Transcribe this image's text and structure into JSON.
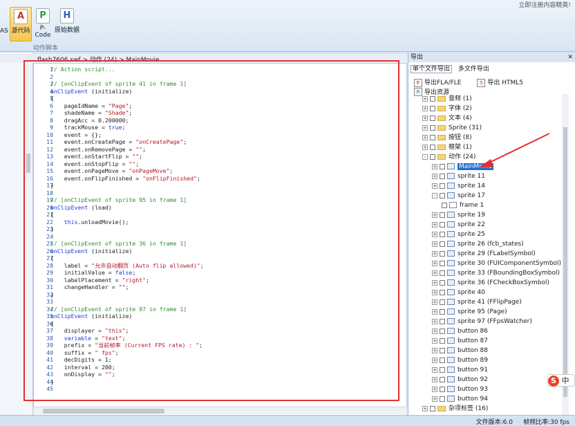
{
  "topright_text": "立即注册内容精英!",
  "ribbon": {
    "partial_label": "AS",
    "buttons": [
      {
        "label": "源代码",
        "icon": "A",
        "active": true
      },
      {
        "label": "P-Code",
        "icon": "P",
        "active": false
      },
      {
        "label": "原始数据",
        "icon": "H",
        "active": false
      }
    ],
    "group_label": "动作脚本"
  },
  "breadcrumb": "flash7606.swf > 动作 (24) > MainMovie",
  "code_lines": [
    [
      [
        "cm",
        "// Action script..."
      ]
    ],
    [],
    [
      [
        "cm",
        "// [onClipEvent of sprite 41 in frame 1]"
      ]
    ],
    [
      [
        "kw",
        "onClipEvent"
      ],
      [
        "pl",
        " (initialize)"
      ]
    ],
    [
      [
        "pl",
        "{"
      ]
    ],
    [
      [
        "pl",
        "    pageIdName = "
      ],
      [
        "st",
        "\"Page\""
      ],
      [
        "pl",
        ";"
      ]
    ],
    [
      [
        "pl",
        "    shadeName = "
      ],
      [
        "st",
        "\"Shade\""
      ],
      [
        "pl",
        ";"
      ]
    ],
    [
      [
        "pl",
        "    dragAcc = 0.200000;"
      ]
    ],
    [
      [
        "pl",
        "    trackMouse = "
      ],
      [
        "kw",
        "true"
      ],
      [
        "pl",
        ";"
      ]
    ],
    [
      [
        "pl",
        "    event = {};"
      ]
    ],
    [
      [
        "pl",
        "    event.onCreatePage = "
      ],
      [
        "st",
        "\"onCreatePage\""
      ],
      [
        "pl",
        ";"
      ]
    ],
    [
      [
        "pl",
        "    event.onRemovePage = "
      ],
      [
        "st",
        "\"\""
      ],
      [
        "pl",
        ";"
      ]
    ],
    [
      [
        "pl",
        "    event.onStartFlip = "
      ],
      [
        "st",
        "\"\""
      ],
      [
        "pl",
        ";"
      ]
    ],
    [
      [
        "pl",
        "    event.onStopFlip = "
      ],
      [
        "st",
        "\"\""
      ],
      [
        "pl",
        ";"
      ]
    ],
    [
      [
        "pl",
        "    event.onPageMove = "
      ],
      [
        "st",
        "\"onPageMove\""
      ],
      [
        "pl",
        ";"
      ]
    ],
    [
      [
        "pl",
        "    event.onFlipFinished = "
      ],
      [
        "st",
        "\"onFlipFinished\""
      ],
      [
        "pl",
        ";"
      ]
    ],
    [
      [
        "pl",
        "}"
      ]
    ],
    [],
    [
      [
        "cm",
        "// [onClipEvent of sprite 95 in frame 1]"
      ]
    ],
    [
      [
        "kw",
        "onClipEvent"
      ],
      [
        "pl",
        " (load)"
      ]
    ],
    [
      [
        "pl",
        "{"
      ]
    ],
    [
      [
        "pl",
        "    "
      ],
      [
        "kw",
        "this"
      ],
      [
        "pl",
        ".unloadMovie();"
      ]
    ],
    [
      [
        "pl",
        "}"
      ]
    ],
    [],
    [
      [
        "cm",
        "// [onClipEvent of sprite 36 in frame 1]"
      ]
    ],
    [
      [
        "kw",
        "onClipEvent"
      ],
      [
        "pl",
        " (initialize)"
      ]
    ],
    [
      [
        "pl",
        "{"
      ]
    ],
    [
      [
        "pl",
        "    label = "
      ],
      [
        "st",
        "\"允许自动翻页 (Auto flip allowed)\""
      ],
      [
        "pl",
        ";"
      ]
    ],
    [
      [
        "pl",
        "    initialValue = "
      ],
      [
        "kw",
        "false"
      ],
      [
        "pl",
        ";"
      ]
    ],
    [
      [
        "pl",
        "    labelPlacement = "
      ],
      [
        "st",
        "\"right\""
      ],
      [
        "pl",
        ";"
      ]
    ],
    [
      [
        "pl",
        "    changeHandler = "
      ],
      [
        "st",
        "\"\""
      ],
      [
        "pl",
        ";"
      ]
    ],
    [
      [
        "pl",
        "}"
      ]
    ],
    [],
    [
      [
        "cm",
        "// [onClipEvent of sprite 97 in frame 1]"
      ]
    ],
    [
      [
        "kw",
        "onClipEvent"
      ],
      [
        "pl",
        " (initialize)"
      ]
    ],
    [
      [
        "pl",
        "{"
      ]
    ],
    [
      [
        "pl",
        "    displayer = "
      ],
      [
        "st",
        "\"this\""
      ],
      [
        "pl",
        ";"
      ]
    ],
    [
      [
        "pl",
        "    "
      ],
      [
        "kw",
        "variable"
      ],
      [
        "pl",
        " = "
      ],
      [
        "st",
        "\"text\""
      ],
      [
        "pl",
        ";"
      ]
    ],
    [
      [
        "pl",
        "    prefix = "
      ],
      [
        "st",
        "\"当前帧率 (Current FPS rate) : \""
      ],
      [
        "pl",
        ";"
      ]
    ],
    [
      [
        "pl",
        "    suffix = "
      ],
      [
        "st",
        "\" fps\""
      ],
      [
        "pl",
        ";"
      ]
    ],
    [
      [
        "pl",
        "    decDigits = 1;"
      ]
    ],
    [
      [
        "pl",
        "    interval = 200;"
      ]
    ],
    [
      [
        "pl",
        "    onDisplay = "
      ],
      [
        "st",
        "\"\""
      ],
      [
        "pl",
        ";"
      ]
    ],
    [
      [
        "pl",
        "}"
      ]
    ],
    []
  ],
  "right_panel": {
    "title": "导出",
    "tabs": [
      "单个文件导出",
      "多文件导出"
    ],
    "toolbar": [
      "导出FLA/FLE",
      "导出 HTML5",
      "导出资源"
    ],
    "tree": [
      {
        "label": "音频 (1)",
        "level": 0,
        "kind": "folder",
        "exp": "+"
      },
      {
        "label": "字体 (2)",
        "level": 0,
        "kind": "folder",
        "exp": "+"
      },
      {
        "label": "文本 (4)",
        "level": 0,
        "kind": "folder",
        "exp": "+"
      },
      {
        "label": "Sprite (31)",
        "level": 0,
        "kind": "folder",
        "exp": "+"
      },
      {
        "label": "按钮 (8)",
        "level": 0,
        "kind": "folder",
        "exp": "+"
      },
      {
        "label": "框架 (1)",
        "level": 0,
        "kind": "folder",
        "exp": "+"
      },
      {
        "label": "动作 (24)",
        "level": 0,
        "kind": "folder",
        "exp": "-"
      },
      {
        "label": "MainMovie",
        "level": 1,
        "kind": "sprite",
        "exp": "+",
        "selected": true
      },
      {
        "label": "sprite 11",
        "level": 1,
        "kind": "sprite",
        "exp": "+"
      },
      {
        "label": "sprite 14",
        "level": 1,
        "kind": "sprite",
        "exp": "+"
      },
      {
        "label": "sprite 17",
        "level": 1,
        "kind": "sprite",
        "exp": "-"
      },
      {
        "label": "frame 1",
        "level": 2,
        "kind": "frame",
        "exp": ""
      },
      {
        "label": "sprite 19",
        "level": 1,
        "kind": "sprite",
        "exp": "+"
      },
      {
        "label": "sprite 22",
        "level": 1,
        "kind": "sprite",
        "exp": "+"
      },
      {
        "label": "sprite 25",
        "level": 1,
        "kind": "sprite",
        "exp": "+"
      },
      {
        "label": "sprite 26 (fcb_states)",
        "level": 1,
        "kind": "sprite",
        "exp": "+"
      },
      {
        "label": "sprite 29 (FLabelSymbol)",
        "level": 1,
        "kind": "sprite",
        "exp": "+"
      },
      {
        "label": "sprite 30 (FUIComponentSymbol)",
        "level": 1,
        "kind": "sprite",
        "exp": "+"
      },
      {
        "label": "sprite 33 (FBoundingBoxSymbol)",
        "level": 1,
        "kind": "sprite",
        "exp": "+"
      },
      {
        "label": "sprite 36 (FCheckBoxSymbol)",
        "level": 1,
        "kind": "sprite",
        "exp": "+"
      },
      {
        "label": "sprite 40",
        "level": 1,
        "kind": "sprite",
        "exp": "+"
      },
      {
        "label": "sprite 41 (FFlipPage)",
        "level": 1,
        "kind": "sprite",
        "exp": "+"
      },
      {
        "label": "sprite 95 (Page)",
        "level": 1,
        "kind": "sprite",
        "exp": "+"
      },
      {
        "label": "sprite 97 (FFpsWatcher)",
        "level": 1,
        "kind": "sprite",
        "exp": "+"
      },
      {
        "label": "button 86",
        "level": 1,
        "kind": "sprite",
        "exp": "+"
      },
      {
        "label": "button 87",
        "level": 1,
        "kind": "sprite",
        "exp": "+"
      },
      {
        "label": "button 88",
        "level": 1,
        "kind": "sprite",
        "exp": "+"
      },
      {
        "label": "button 89",
        "level": 1,
        "kind": "sprite",
        "exp": "+"
      },
      {
        "label": "button 91",
        "level": 1,
        "kind": "sprite",
        "exp": "+"
      },
      {
        "label": "button 92",
        "level": 1,
        "kind": "sprite",
        "exp": "+"
      },
      {
        "label": "button 93",
        "level": 1,
        "kind": "sprite",
        "exp": "+"
      },
      {
        "label": "button 94",
        "level": 1,
        "kind": "sprite",
        "exp": "+"
      },
      {
        "label": "杂项标签 (16)",
        "level": 0,
        "kind": "folder",
        "exp": "+"
      }
    ]
  },
  "status": {
    "version": "文件版本:6.0",
    "fps": "帧频比率:30 fps"
  },
  "ime": {
    "logo": "S",
    "text": "中"
  },
  "colors": {
    "accent": "#1d6fd1",
    "annotation": "#e23030"
  }
}
